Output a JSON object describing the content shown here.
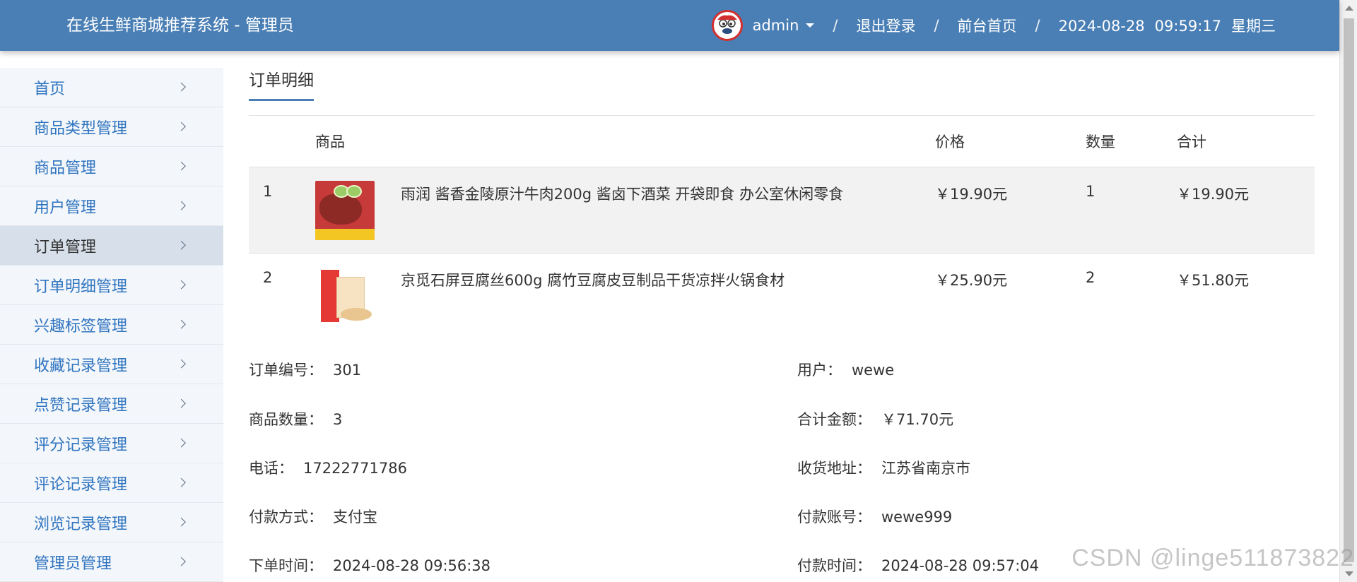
{
  "header": {
    "title": "在线生鲜商城推荐系统 - 管理员",
    "username": "admin",
    "separator": "/",
    "logout": "退出登录",
    "front_home": "前台首页",
    "date": "2024-08-28",
    "time": "09:59:17",
    "weekday": "星期三",
    "bg_color": "#4a7fb5"
  },
  "sidebar": {
    "items": [
      {
        "label": "首页"
      },
      {
        "label": "商品类型管理"
      },
      {
        "label": "商品管理"
      },
      {
        "label": "用户管理"
      },
      {
        "label": "订单管理"
      },
      {
        "label": "订单明细管理"
      },
      {
        "label": "兴趣标签管理"
      },
      {
        "label": "收藏记录管理"
      },
      {
        "label": "点赞记录管理"
      },
      {
        "label": "评分记录管理"
      },
      {
        "label": "评论记录管理"
      },
      {
        "label": "浏览记录管理"
      },
      {
        "label": "管理员管理"
      }
    ],
    "active_index": 4
  },
  "main": {
    "tab": "订单明细",
    "table": {
      "headers": {
        "product": "商品",
        "price": "价格",
        "qty": "数量",
        "total": "合计"
      },
      "rows": [
        {
          "index": "1",
          "name": "雨润 酱香金陵原汁牛肉200g 酱卤下酒菜 开袋即食 办公室休闲零食",
          "price": "￥19.90元",
          "qty": "1",
          "total": "￥19.90元",
          "image": "beef-product-image"
        },
        {
          "index": "2",
          "name": "京觅石屏豆腐丝600g 腐竹豆腐皮豆制品干货凉拌火锅食材",
          "price": "￥25.90元",
          "qty": "2",
          "total": "￥51.80元",
          "image": "tofu-product-image"
        }
      ]
    },
    "details": {
      "order_no": {
        "label": "订单编号：",
        "value": "301"
      },
      "user": {
        "label": "用户：",
        "value": "wewe"
      },
      "item_count": {
        "label": "商品数量：",
        "value": "3"
      },
      "total_amount": {
        "label": "合计金额：",
        "value": "￥71.70元"
      },
      "phone": {
        "label": "电话：",
        "value": "17222771786"
      },
      "address": {
        "label": "收货地址：",
        "value": "江苏省南京市"
      },
      "pay_method": {
        "label": "付款方式：",
        "value": "支付宝"
      },
      "pay_account": {
        "label": "付款账号：",
        "value": "wewe999"
      },
      "order_time": {
        "label": "下单时间：",
        "value": "2024-08-28 09:56:38"
      },
      "pay_time": {
        "label": "付款时间：",
        "value": "2024-08-28 09:57:04"
      }
    }
  },
  "watermark": "CSDN @linge511873822"
}
